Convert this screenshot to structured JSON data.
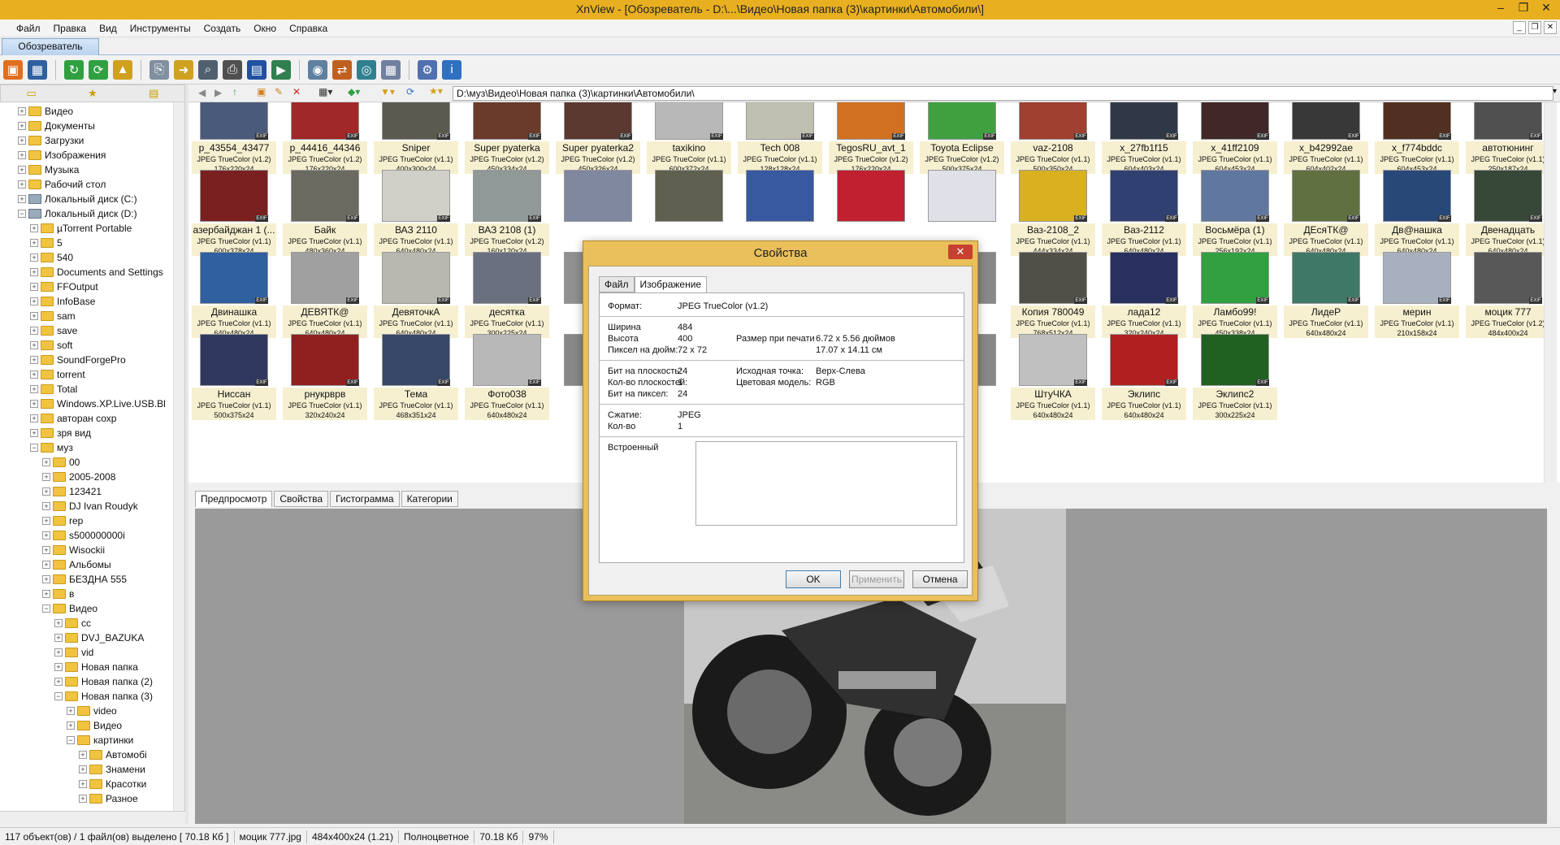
{
  "window": {
    "title": "XnView - [Обозреватель - D:\\...\\Видео\\Новая папка (3)\\картинки\\Автомобили\\]"
  },
  "menu": [
    "Файл",
    "Правка",
    "Вид",
    "Инструменты",
    "Создать",
    "Окно",
    "Справка"
  ],
  "main_tab": "Обозреватель",
  "address": "D:\\муз\\Видео\\Новая папка (3)\\картинки\\Автомобили\\",
  "tree": [
    {
      "label": "Видео",
      "indent": 1,
      "kind": "folder"
    },
    {
      "label": "Документы",
      "indent": 1,
      "kind": "folder"
    },
    {
      "label": "Загрузки",
      "indent": 1,
      "kind": "folder"
    },
    {
      "label": "Изображения",
      "indent": 1,
      "kind": "folder"
    },
    {
      "label": "Музыка",
      "indent": 1,
      "kind": "folder"
    },
    {
      "label": "Рабочий стол",
      "indent": 1,
      "kind": "folder"
    },
    {
      "label": "Локальный диск (C:)",
      "indent": 1,
      "kind": "drive"
    },
    {
      "label": "Локальный диск (D:)",
      "indent": 1,
      "kind": "drive",
      "open": true
    },
    {
      "label": "µTorrent Portable",
      "indent": 2,
      "kind": "folder"
    },
    {
      "label": "5",
      "indent": 2,
      "kind": "folder"
    },
    {
      "label": "540",
      "indent": 2,
      "kind": "folder"
    },
    {
      "label": "Documents and Settings",
      "indent": 2,
      "kind": "folder"
    },
    {
      "label": "FFOutput",
      "indent": 2,
      "kind": "folder"
    },
    {
      "label": "InfoBase",
      "indent": 2,
      "kind": "folder"
    },
    {
      "label": "sam",
      "indent": 2,
      "kind": "folder"
    },
    {
      "label": "save",
      "indent": 2,
      "kind": "folder"
    },
    {
      "label": "soft",
      "indent": 2,
      "kind": "folder"
    },
    {
      "label": "SoundForgePro",
      "indent": 2,
      "kind": "folder"
    },
    {
      "label": "torrent",
      "indent": 2,
      "kind": "folder"
    },
    {
      "label": "Total",
      "indent": 2,
      "kind": "folder"
    },
    {
      "label": "Windows.XP.Live.USB.Bl",
      "indent": 2,
      "kind": "folder"
    },
    {
      "label": "авторан сохр",
      "indent": 2,
      "kind": "folder"
    },
    {
      "label": "зря вид",
      "indent": 2,
      "kind": "folder"
    },
    {
      "label": "муз",
      "indent": 2,
      "kind": "folder",
      "open": true
    },
    {
      "label": "00",
      "indent": 3,
      "kind": "folder"
    },
    {
      "label": "2005-2008",
      "indent": 3,
      "kind": "folder"
    },
    {
      "label": "123421",
      "indent": 3,
      "kind": "folder"
    },
    {
      "label": "DJ Ivan Roudyk",
      "indent": 3,
      "kind": "folder"
    },
    {
      "label": "rep",
      "indent": 3,
      "kind": "folder"
    },
    {
      "label": "s500000000i",
      "indent": 3,
      "kind": "folder"
    },
    {
      "label": "Wisockii",
      "indent": 3,
      "kind": "folder"
    },
    {
      "label": "Альбомы",
      "indent": 3,
      "kind": "folder"
    },
    {
      "label": "БЕЗДНА 555",
      "indent": 3,
      "kind": "folder"
    },
    {
      "label": "в",
      "indent": 3,
      "kind": "folder"
    },
    {
      "label": "Видео",
      "indent": 3,
      "kind": "folder",
      "open": true
    },
    {
      "label": "cc",
      "indent": 4,
      "kind": "folder"
    },
    {
      "label": "DVJ_BAZUKA",
      "indent": 4,
      "kind": "folder"
    },
    {
      "label": "vid",
      "indent": 4,
      "kind": "folder"
    },
    {
      "label": "Новая папка",
      "indent": 4,
      "kind": "folder"
    },
    {
      "label": "Новая папка (2)",
      "indent": 4,
      "kind": "folder"
    },
    {
      "label": "Новая папка (3)",
      "indent": 4,
      "kind": "folder",
      "open": true
    },
    {
      "label": "video",
      "indent": 5,
      "kind": "folder"
    },
    {
      "label": "Видео",
      "indent": 5,
      "kind": "folder"
    },
    {
      "label": "картинки",
      "indent": 5,
      "kind": "folder",
      "open": true
    },
    {
      "label": "Автомобі",
      "indent": 6,
      "kind": "folder"
    },
    {
      "label": "Знамени",
      "indent": 6,
      "kind": "folder"
    },
    {
      "label": "Красотки",
      "indent": 6,
      "kind": "folder"
    },
    {
      "label": "Разное",
      "indent": 6,
      "kind": "folder"
    }
  ],
  "thumbnails": [
    {
      "name": "p_43554_43477",
      "format": "JPEG TrueColor (v1.2)",
      "size": "176x220x24",
      "color": "#4a5a7a"
    },
    {
      "name": "p_44416_44346",
      "format": "JPEG TrueColor (v1.2)",
      "size": "176x220x24",
      "color": "#a02828"
    },
    {
      "name": "Sniper",
      "format": "JPEG TrueColor (v1.1)",
      "size": "400x300x24",
      "color": "#5a5a50"
    },
    {
      "name": "Super pyaterka",
      "format": "JPEG TrueColor (v1.2)",
      "size": "450x334x24",
      "color": "#6a3a2a"
    },
    {
      "name": "Super pyaterka2",
      "format": "JPEG TrueColor (v1.2)",
      "size": "450x326x24",
      "color": "#5a3a30"
    },
    {
      "name": "taxikino",
      "format": "JPEG TrueColor (v1.1)",
      "size": "600x372x24",
      "color": "#b8b8b8"
    },
    {
      "name": "Tech 008",
      "format": "JPEG TrueColor (v1.1)",
      "size": "128x128x24",
      "color": "#c0c0b0"
    },
    {
      "name": "TegosRU_avt_1",
      "format": "JPEG TrueColor (v1.2)",
      "size": "176x220x24",
      "color": "#d07020"
    },
    {
      "name": "Toyota Eclipse",
      "format": "JPEG TrueColor (v1.2)",
      "size": "500x375x24",
      "color": "#40a040"
    },
    {
      "name": "vaz-2108",
      "format": "JPEG TrueColor (v1.1)",
      "size": "500x350x24",
      "color": "#a04030"
    },
    {
      "name": "x_27fb1f15",
      "format": "JPEG TrueColor (v1.1)",
      "size": "604x403x24",
      "color": "#303848"
    },
    {
      "name": "x_41ff2109",
      "format": "JPEG TrueColor (v1.1)",
      "size": "604x453x24",
      "color": "#402828"
    },
    {
      "name": "x_b42992ae",
      "format": "JPEG TrueColor (v1.1)",
      "size": "604x402x24",
      "color": "#383838"
    },
    {
      "name": "x_f774bddc",
      "format": "JPEG TrueColor (v1.1)",
      "size": "604x453x24",
      "color": "#503020"
    },
    {
      "name": "автотюнинг",
      "format": "JPEG TrueColor (v1.1)",
      "size": "250x187x24",
      "color": "#505050"
    },
    {
      "name": "азербайджан 1 (...",
      "format": "JPEG TrueColor (v1.1)",
      "size": "600x378x24",
      "color": "#7a2020"
    },
    {
      "name": "Байк",
      "format": "JPEG TrueColor (v1.1)",
      "size": "480x360x24",
      "color": "#6a6a60"
    },
    {
      "name": "ВАЗ  2110",
      "format": "JPEG TrueColor (v1.1)",
      "size": "640x480x24",
      "color": "#d0d0c8"
    },
    {
      "name": "ВАЗ 2108 (1)",
      "format": "JPEG TrueColor (v1.2)",
      "size": "160x120x24",
      "color": "#909898"
    },
    {
      "name": "",
      "format": "",
      "size": "",
      "color": "#8088a0"
    },
    {
      "name": "",
      "format": "",
      "size": "",
      "color": "#606050"
    },
    {
      "name": "",
      "format": "",
      "size": "",
      "color": "#3858a0"
    },
    {
      "name": "",
      "format": "",
      "size": "",
      "color": "#c02030"
    },
    {
      "name": "",
      "format": "",
      "size": "",
      "color": "#e0e0e8"
    },
    {
      "name": "Ваз-2108_2",
      "format": "JPEG TrueColor (v1.1)",
      "size": "444x334x24",
      "color": "#d8b020"
    },
    {
      "name": "Ваз-2112",
      "format": "JPEG TrueColor (v1.1)",
      "size": "640x480x24",
      "color": "#304070"
    },
    {
      "name": "Восьмёра (1)",
      "format": "JPEG TrueColor (v1.1)",
      "size": "256x192x24",
      "color": "#6078a0"
    },
    {
      "name": "ДЕсяТК@",
      "format": "JPEG TrueColor (v1.1)",
      "size": "640x480x24",
      "color": "#607040"
    },
    {
      "name": "Дв@нашка",
      "format": "JPEG TrueColor (v1.1)",
      "size": "640x480x24",
      "color": "#284878"
    },
    {
      "name": "Двенадцать",
      "format": "JPEG TrueColor (v1.1)",
      "size": "640x480x24",
      "color": "#384838"
    },
    {
      "name": "Двинашка",
      "format": "JPEG TrueColor (v1.1)",
      "size": "640x480x24",
      "color": "#3060a0"
    },
    {
      "name": "ДЕВЯТК@",
      "format": "JPEG TrueColor (v1.1)",
      "size": "640x480x24",
      "color": "#a0a0a0"
    },
    {
      "name": "ДевяточкА",
      "format": "JPEG TrueColor (v1.1)",
      "size": "640x480x24",
      "color": "#b8b8b0"
    },
    {
      "name": "десятка",
      "format": "JPEG TrueColor (v1.1)",
      "size": "300x225x24",
      "color": "#6a7080"
    },
    {
      "name": "",
      "format": "",
      "size": "",
      "color": "#909090"
    },
    {
      "name": "",
      "format": "",
      "size": "",
      "color": "#888"
    },
    {
      "name": "",
      "format": "",
      "size": "",
      "color": "#888"
    },
    {
      "name": "",
      "format": "",
      "size": "",
      "color": "#888"
    },
    {
      "name": "",
      "format": "",
      "size": "",
      "color": "#888"
    },
    {
      "name": "Копия 780049",
      "format": "JPEG TrueColor (v1.1)",
      "size": "768x512x24",
      "color": "#505048"
    },
    {
      "name": "лада12",
      "format": "JPEG TrueColor (v1.1)",
      "size": "320x240x24",
      "color": "#283060"
    },
    {
      "name": "Ламбо99!",
      "format": "JPEG TrueColor (v1.1)",
      "size": "450x338x24",
      "color": "#30a040"
    },
    {
      "name": "ЛидеР",
      "format": "JPEG TrueColor (v1.1)",
      "size": "640x480x24",
      "color": "#407868"
    },
    {
      "name": "мерин",
      "format": "JPEG TrueColor (v1.1)",
      "size": "210x158x24",
      "color": "#a8b0c0"
    },
    {
      "name": "моцик 777",
      "format": "JPEG TrueColor (v1.2)",
      "size": "484x400x24",
      "color": "#585858"
    },
    {
      "name": "Ниссан",
      "format": "JPEG TrueColor (v1.1)",
      "size": "500x375x24",
      "color": "#303860"
    },
    {
      "name": "рнукрврв",
      "format": "JPEG TrueColor (v1.1)",
      "size": "320x240x24",
      "color": "#902020"
    },
    {
      "name": "Тема",
      "format": "JPEG TrueColor (v1.1)",
      "size": "468x351x24",
      "color": "#384868"
    },
    {
      "name": "Фото038",
      "format": "JPEG TrueColor (v1.1)",
      "size": "640x480x24",
      "color": "#b8b8b8"
    },
    {
      "name": "",
      "format": "",
      "size": "",
      "color": "#888"
    },
    {
      "name": "",
      "format": "",
      "size": "",
      "color": "#888"
    },
    {
      "name": "",
      "format": "",
      "size": "",
      "color": "#888"
    },
    {
      "name": "",
      "format": "",
      "size": "",
      "color": "#888"
    },
    {
      "name": "",
      "format": "",
      "size": "",
      "color": "#888"
    },
    {
      "name": "ШтуЧКА",
      "format": "JPEG TrueColor (v1.1)",
      "size": "640x480x24",
      "color": "#c0c0c0"
    },
    {
      "name": "Эклипс",
      "format": "JPEG TrueColor (v1.1)",
      "size": "640x480x24",
      "color": "#b02020"
    },
    {
      "name": "Эклипс2",
      "format": "JPEG TrueColor (v1.1)",
      "size": "300x225x24",
      "color": "#206020"
    }
  ],
  "lower_tabs": [
    "Предпросмотр",
    "Свойства",
    "Гистограмма",
    "Категории"
  ],
  "status": {
    "count": "117 объект(ов) / 1 файл(ов) выделено  [ 70.18 Кб ]",
    "file": "моцик 777.jpg",
    "dims": "484x400x24 (1.21)",
    "color_mode": "Полноцветное",
    "size": "70.18 Кб",
    "zoom": "97%"
  },
  "dialog": {
    "title": "Свойства",
    "tabs": [
      "Файл",
      "Изображение"
    ],
    "format_label": "Формат:",
    "format_value": "JPEG TrueColor (v1.2)",
    "width_label": "Ширина",
    "width_value": "484",
    "height_label": "Высота",
    "height_value": "400",
    "dpi_label": "Пиксел на дюйм:",
    "dpi_value": "72 x 72",
    "print_label": "Размер при печати",
    "print_value1": "6.72 x 5.56 дюймов",
    "print_value2": "17.07 x 14.11 см",
    "bpp_label": "Бит на плоскость:",
    "bpp_value": "24",
    "planes_label": "Кол-во плоскостей:",
    "planes_value": "1",
    "bpx_label": "Бит на пиксел:",
    "bpx_value": "24",
    "origin_label": "Исходная точка:",
    "origin_value": "Верх-Слева",
    "colormodel_label": "Цветовая модель:",
    "colormodel_value": "RGB",
    "compress_label": "Сжатие:",
    "compress_value": "JPEG",
    "count_label": "Кол-во",
    "count_value": "1",
    "embedded_label": "Встроенный",
    "ok": "OK",
    "apply": "Применить",
    "cancel": "Отмена"
  }
}
